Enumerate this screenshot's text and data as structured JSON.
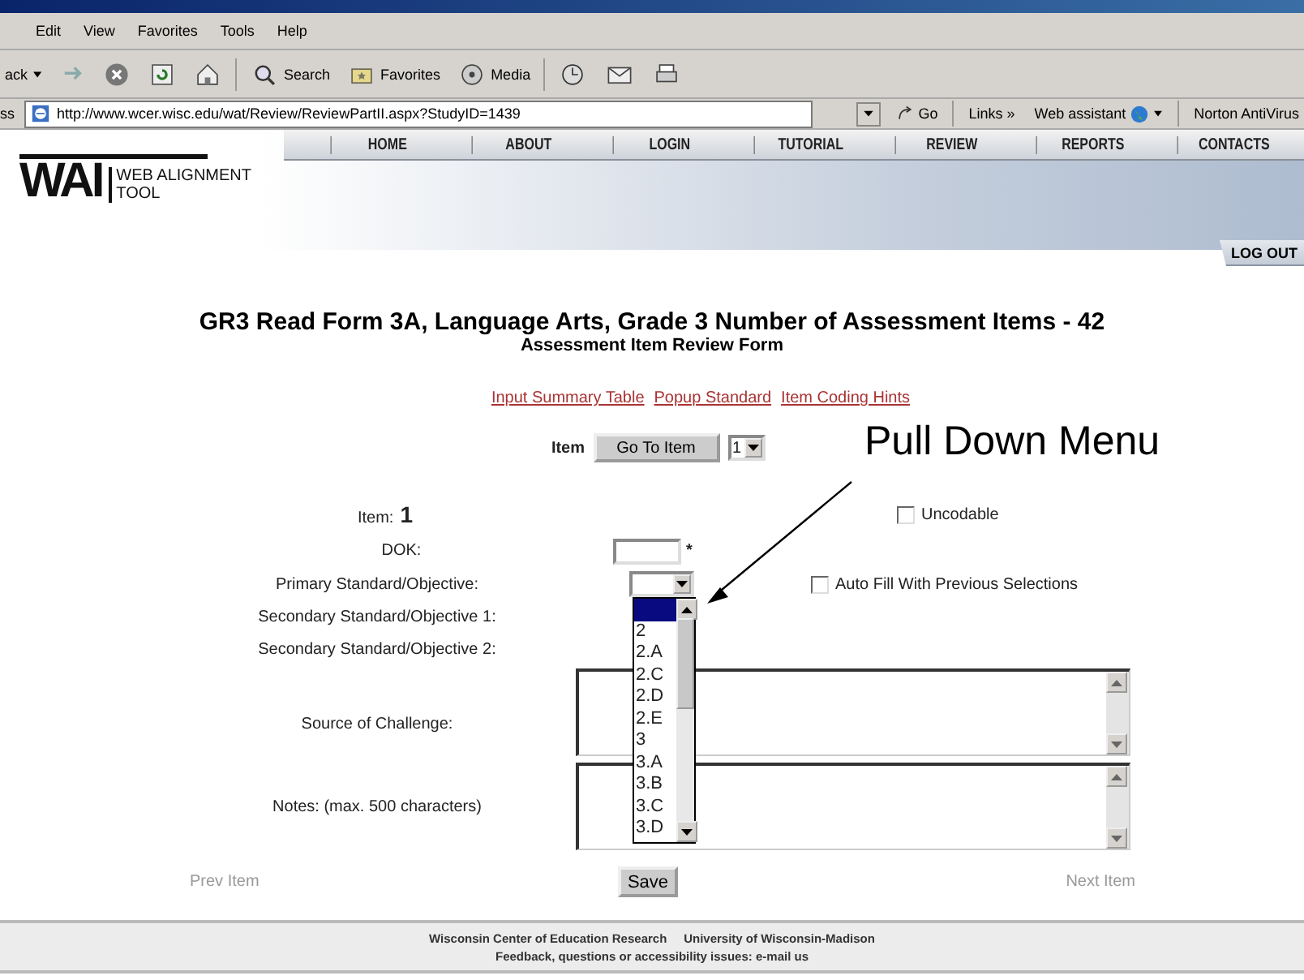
{
  "browser": {
    "menu": [
      "Edit",
      "View",
      "Favorites",
      "Tools",
      "Help"
    ],
    "toolbar": [
      {
        "kind": "back",
        "label": "ack"
      },
      {
        "kind": "forward"
      },
      {
        "kind": "stop"
      },
      {
        "kind": "refresh"
      },
      {
        "kind": "home"
      },
      {
        "kind": "search",
        "label": "Search"
      },
      {
        "kind": "favorites",
        "label": "Favorites"
      },
      {
        "kind": "media",
        "label": "Media"
      },
      {
        "kind": "history"
      },
      {
        "kind": "mail"
      },
      {
        "kind": "print"
      }
    ],
    "address": {
      "label": "ss",
      "url": "http://www.wcer.wisc.edu/wat/Review/ReviewPartII.aspx?StudyID=1439",
      "go": "Go",
      "links": "Links »",
      "assistant": "Web assistant",
      "antivirus": "Norton AntiVirus"
    }
  },
  "site": {
    "logo": {
      "mark": "WAI",
      "line1": "WEB ALIGNMENT",
      "line2": "TOOL"
    },
    "nav": [
      "HOME",
      "ABOUT",
      "LOGIN",
      "TUTORIAL",
      "REVIEW",
      "REPORTS",
      "CONTACTS"
    ],
    "logout": "LOG OUT"
  },
  "form": {
    "title": "GR3 Read Form 3A, Language Arts, Grade 3 Number of Assessment Items - 42",
    "subtitle": "Assessment Item Review Form",
    "links": [
      "Input Summary Table",
      "Popup Standard",
      "Item Coding Hints"
    ],
    "item_picker": {
      "label": "Item",
      "button": "Go To Item",
      "value": "1"
    },
    "item_number": {
      "label": "Item:",
      "value": "1"
    },
    "uncodable": {
      "label": "Uncodable",
      "checked": false
    },
    "dok": {
      "label": "DOK:",
      "required": "*"
    },
    "primary": {
      "label": "Primary Standard/Objective:",
      "open": true,
      "blank_option": {
        "selected": true
      },
      "options": [
        {
          "label": "2",
          "selected": false
        },
        {
          "label": "2.A",
          "selected": false
        },
        {
          "label": "2.C",
          "selected": false
        },
        {
          "label": "2.D",
          "selected": false
        },
        {
          "label": "2.E",
          "selected": false
        },
        {
          "label": "3",
          "selected": false
        },
        {
          "label": "3.A",
          "selected": false
        },
        {
          "label": "3.B",
          "selected": false
        },
        {
          "label": "3.C",
          "selected": false
        },
        {
          "label": "3.D",
          "selected": false
        }
      ]
    },
    "auto_fill": {
      "label": "Auto Fill With Previous Selections",
      "checked": false
    },
    "secondary_1": {
      "label": "Secondary Standard/Objective 1:"
    },
    "secondary_2": {
      "label": "Secondary Standard/Objective 2:"
    },
    "source_of_challenge": {
      "label": "Source of Challenge:"
    },
    "notes": {
      "label": "Notes: (max. 500 characters)"
    },
    "prev": {
      "label": "Prev Item",
      "disabled": true
    },
    "save": "Save",
    "next": {
      "label": "Next Item",
      "disabled": true
    }
  },
  "footer": {
    "line1": "Wisconsin Center of Education Research     University of Wisconsin-Madison",
    "line2": "Feedback, questions or accessibility issues: e-mail us"
  },
  "annotation": {
    "label": "Pull Down Menu"
  }
}
